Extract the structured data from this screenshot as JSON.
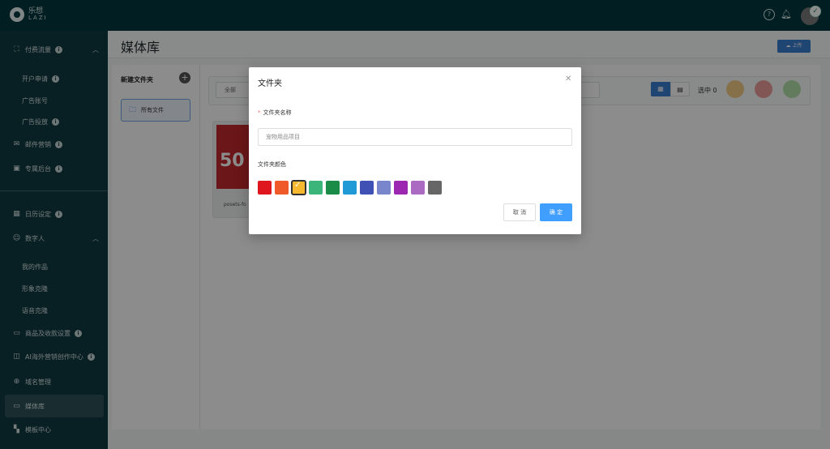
{
  "brand": {
    "name_cn": "乐想",
    "name_en": "LAZI"
  },
  "sidebar": {
    "items": [
      {
        "label": "付费流量",
        "icon": "chart-icon"
      },
      {
        "label": "开户申请"
      },
      {
        "label": "广告账号"
      },
      {
        "label": "广告投放"
      },
      {
        "label": "邮件营销",
        "icon": "mail-icon"
      },
      {
        "label": "专属后台",
        "icon": "image-icon"
      },
      {
        "label": "日历设定",
        "icon": "calendar-icon"
      },
      {
        "label": "数字人",
        "icon": "user-icon"
      },
      {
        "label": "我的作品"
      },
      {
        "label": "形象克隆"
      },
      {
        "label": "语音克隆"
      },
      {
        "label": "商品及收款设置",
        "icon": "card-icon"
      },
      {
        "label": "AI海外营销创作中心",
        "icon": "ai-icon"
      },
      {
        "label": "域名管理",
        "icon": "globe-icon"
      },
      {
        "label": "媒体库",
        "icon": "media-icon"
      },
      {
        "label": "模板中心",
        "icon": "grid-icon"
      }
    ]
  },
  "page": {
    "title": "媒体库",
    "upload_label": "上传"
  },
  "folders": {
    "new_label": "新建文件夹",
    "all_label": "所有文件"
  },
  "toolbar": {
    "filter_value": "全部",
    "selected_label": "选中 0"
  },
  "media": {
    "thumb_text": "50",
    "name": "posets-fo"
  },
  "modal": {
    "title": "文件夹",
    "name_label": "文件夹名称",
    "name_value": "宠物用品项目",
    "color_label": "文件夹颜色",
    "colors": [
      "#e0161f",
      "#f05a28",
      "#f5b82e",
      "#3bb57a",
      "#1a8c48",
      "#1f9ad6",
      "#3f51b5",
      "#7986cb",
      "#9c27b0",
      "#ab6bc2",
      "#666666"
    ],
    "selected_color": "#f5b82e",
    "cancel_label": "取 消",
    "ok_label": "确 定"
  }
}
